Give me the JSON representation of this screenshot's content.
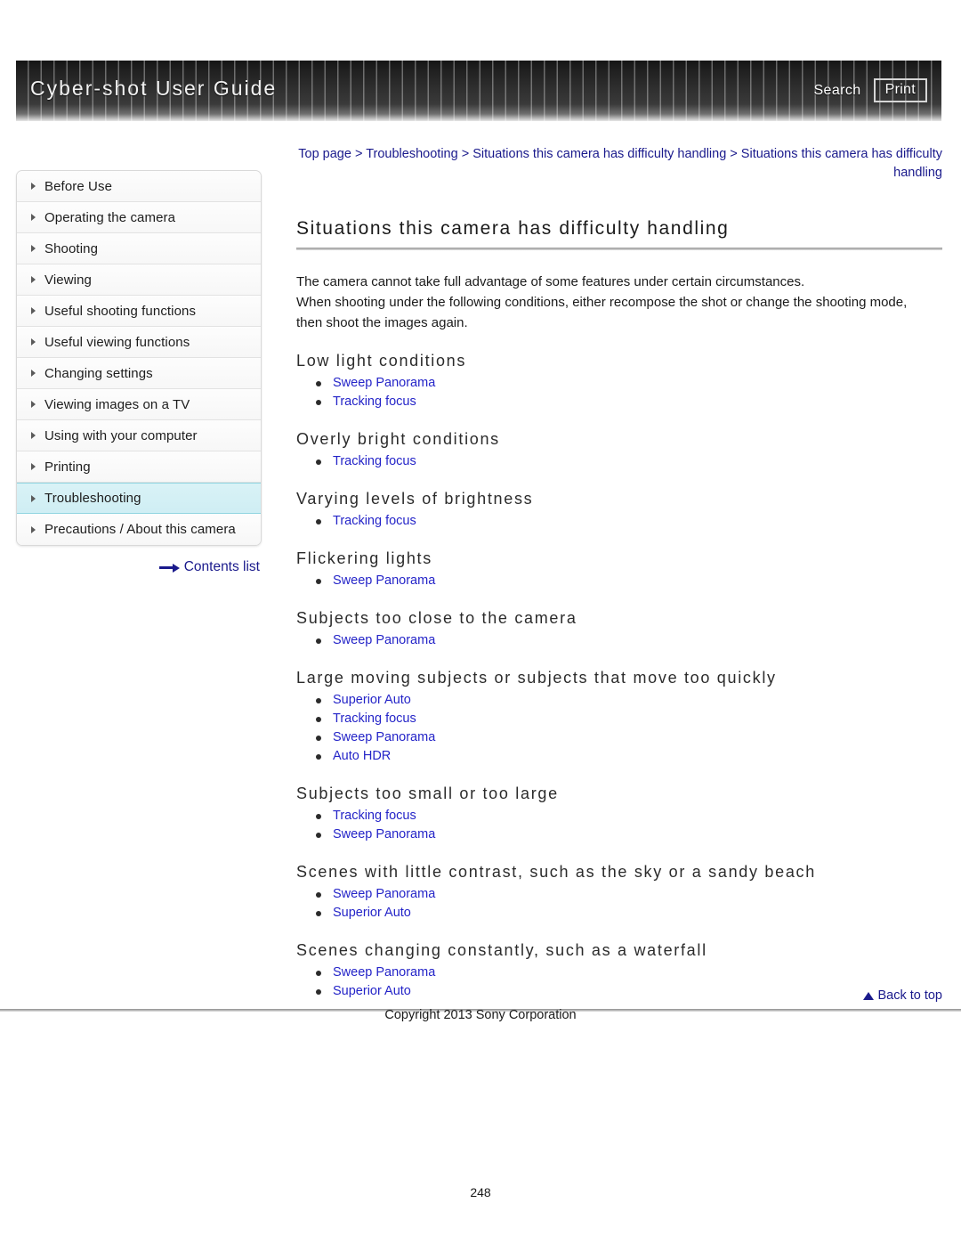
{
  "header": {
    "title": "Cyber-shot User Guide",
    "search_label": "Search",
    "print_label": "Print"
  },
  "breadcrumb": {
    "items": [
      "Top page",
      "Troubleshooting",
      "Situations this camera has difficulty handling",
      "Situations this camera has difficulty handling"
    ],
    "separator": ">"
  },
  "sidebar": {
    "items": [
      {
        "label": "Before Use",
        "active": false
      },
      {
        "label": "Operating the camera",
        "active": false
      },
      {
        "label": "Shooting",
        "active": false
      },
      {
        "label": "Viewing",
        "active": false
      },
      {
        "label": "Useful shooting functions",
        "active": false
      },
      {
        "label": "Useful viewing functions",
        "active": false
      },
      {
        "label": "Changing settings",
        "active": false
      },
      {
        "label": "Viewing images on a TV",
        "active": false
      },
      {
        "label": "Using with your computer",
        "active": false
      },
      {
        "label": "Printing",
        "active": false
      },
      {
        "label": "Troubleshooting",
        "active": true
      },
      {
        "label": "Precautions / About this camera",
        "active": false
      }
    ],
    "contents_list_label": "Contents list"
  },
  "main": {
    "title": "Situations this camera has difficulty handling",
    "intro_line1": "The camera cannot take full advantage of some features under certain circumstances.",
    "intro_line2": "When shooting under the following conditions, either recompose the shot or change the shooting mode,",
    "intro_line3": "then shoot the images again.",
    "sections": [
      {
        "title": "Low light conditions",
        "links": [
          "Sweep Panorama",
          "Tracking focus"
        ]
      },
      {
        "title": "Overly bright conditions",
        "links": [
          "Tracking focus"
        ]
      },
      {
        "title": "Varying levels of brightness",
        "links": [
          "Tracking focus"
        ]
      },
      {
        "title": "Flickering lights",
        "links": [
          "Sweep Panorama"
        ]
      },
      {
        "title": "Subjects too close to the camera",
        "links": [
          "Sweep Panorama"
        ]
      },
      {
        "title": "Large moving subjects or subjects that move too quickly",
        "links": [
          "Superior Auto",
          "Tracking focus",
          "Sweep Panorama",
          "Auto HDR"
        ]
      },
      {
        "title": "Subjects too small or too large",
        "links": [
          "Tracking focus",
          "Sweep Panorama"
        ]
      },
      {
        "title": "Scenes with little contrast, such as the sky or a sandy beach",
        "links": [
          "Sweep Panorama",
          "Superior Auto"
        ]
      },
      {
        "title": "Scenes changing constantly, such as a waterfall",
        "links": [
          "Sweep Panorama",
          "Superior Auto"
        ]
      }
    ]
  },
  "footer": {
    "back_to_top_label": "Back to top",
    "copyright": "Copyright 2013 Sony Corporation",
    "page_number": "248"
  },
  "colors": {
    "link": "#2424c8",
    "breadcrumb": "#1a1a8c",
    "active_sidebar": "#cfeef4"
  }
}
